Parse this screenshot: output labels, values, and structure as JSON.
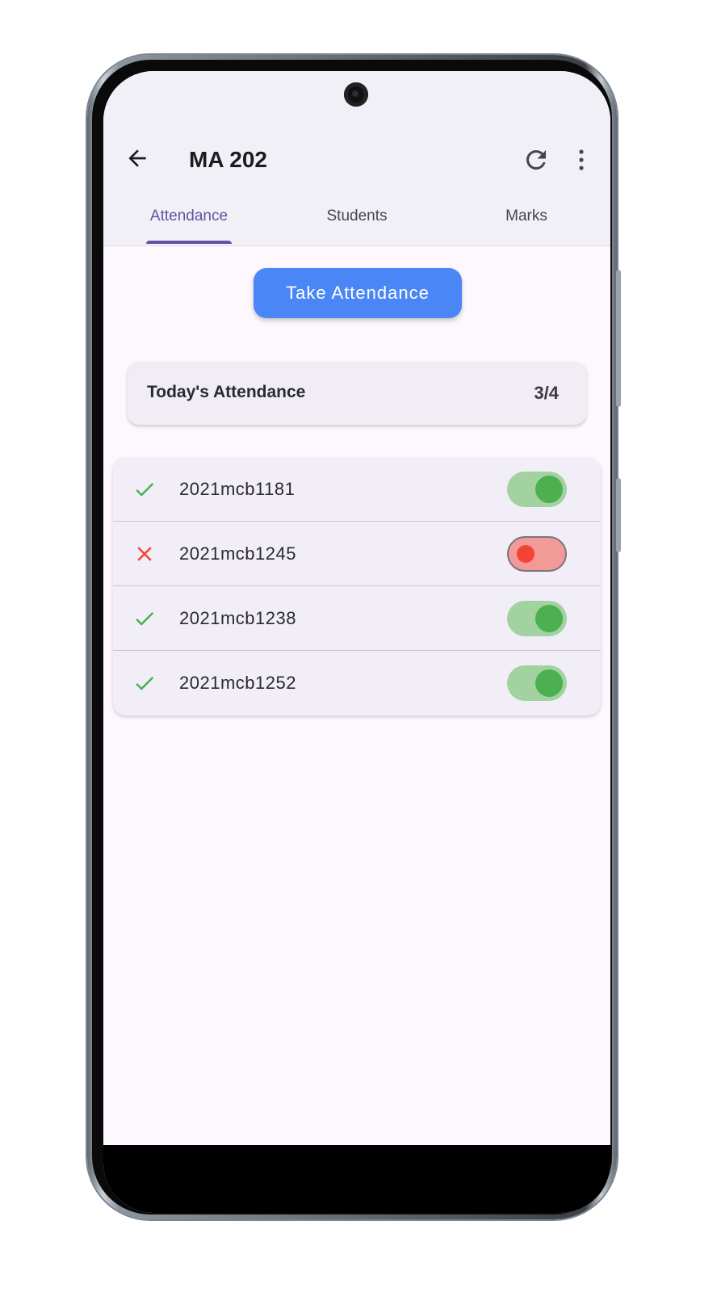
{
  "header": {
    "title": "MA 202"
  },
  "tabs": [
    {
      "label": "Attendance",
      "active": true
    },
    {
      "label": "Students",
      "active": false
    },
    {
      "label": "Marks",
      "active": false
    }
  ],
  "actions": {
    "take_attendance_label": "Take Attendance"
  },
  "summary": {
    "label": "Today's Attendance",
    "count": "3/4"
  },
  "students": [
    {
      "roll": "2021mcb1181",
      "present": true
    },
    {
      "roll": "2021mcb1245",
      "present": false
    },
    {
      "roll": "2021mcb1238",
      "present": true
    },
    {
      "roll": "2021mcb1252",
      "present": true
    }
  ],
  "colors": {
    "accent": "#6750a4",
    "button": "#4a86f6",
    "present": "#4caf50",
    "absent": "#f44336"
  },
  "icons": {
    "back": "arrow-back-icon",
    "refresh": "refresh-icon",
    "menu": "more-vert-icon",
    "present": "check-icon",
    "absent": "close-icon"
  }
}
